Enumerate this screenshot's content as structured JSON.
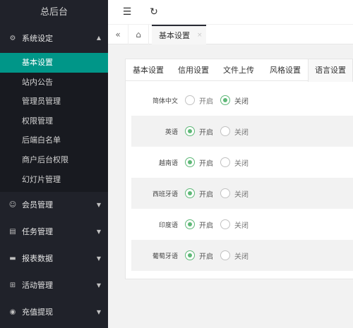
{
  "brand": "总后台",
  "topbar": {
    "menu_icon": "☰",
    "refresh_icon": "↻"
  },
  "tabstrip": {
    "prev_icon": "«",
    "home_icon": "⌂",
    "current_tab": "基本设置",
    "close_icon": "×"
  },
  "sidebar": {
    "system": {
      "label": "系统设定",
      "arrow": "▲"
    },
    "sub_items": [
      "基本设置",
      "站内公告",
      "管理员管理",
      "权限管理",
      "后端白名单",
      "商户后台权限",
      "幻灯片管理"
    ],
    "groups": [
      {
        "label": "会员管理",
        "icon": "☺",
        "arrow": "▼"
      },
      {
        "label": "任务管理",
        "icon": "▤",
        "arrow": "▼"
      },
      {
        "label": "报表数据",
        "icon": "▬",
        "arrow": "▼"
      },
      {
        "label": "活动管理",
        "icon": "⊞",
        "arrow": "▼"
      },
      {
        "label": "充值提现",
        "icon": "◉",
        "arrow": "▼"
      }
    ]
  },
  "settings_tabs": [
    "基本设置",
    "信用设置",
    "文件上传",
    "风格设置",
    "语言设置"
  ],
  "active_settings_tab": "语言设置",
  "radio_labels": {
    "on": "开启",
    "off": "关闭"
  },
  "languages": [
    {
      "label": "简体中文",
      "enabled": false
    },
    {
      "label": "英语",
      "enabled": true
    },
    {
      "label": "越南语",
      "enabled": true
    },
    {
      "label": "西班牙语",
      "enabled": true
    },
    {
      "label": "印度语",
      "enabled": true
    },
    {
      "label": "葡萄牙语",
      "enabled": true
    }
  ]
}
